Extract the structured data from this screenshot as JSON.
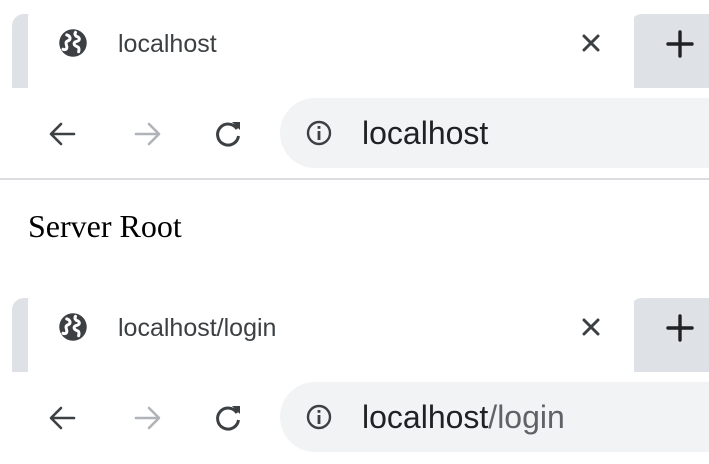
{
  "colors": {
    "tab_strip_grey": "#dee1e6",
    "omnibox_bg": "#f1f3f4",
    "icon_dark": "#3c4043",
    "icon_disabled": "#b0b3b8",
    "url_path": "#5f6368"
  },
  "browser1": {
    "tab": {
      "title": "localhost",
      "favicon": "globe-icon"
    },
    "new_tab_icon": "plus-icon",
    "omnibox": {
      "url_host": "localhost",
      "url_path": ""
    }
  },
  "page": {
    "body_text": "Server Root"
  },
  "browser2": {
    "tab": {
      "title": "localhost/login",
      "favicon": "globe-icon"
    },
    "new_tab_icon": "plus-icon",
    "omnibox": {
      "url_host": "localhost",
      "url_path": "/login"
    }
  }
}
